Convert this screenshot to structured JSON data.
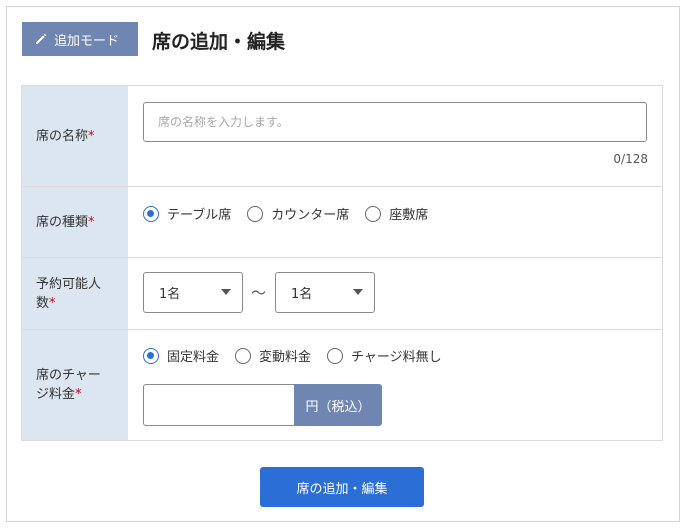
{
  "header": {
    "mode_badge_label": "追加モード",
    "mode_badge_icon": "pencil-icon",
    "title": "席の追加・編集"
  },
  "form": {
    "name": {
      "label": "席の名称",
      "required_mark": "*",
      "placeholder": "席の名称を入力します。",
      "value": "",
      "counter": "0/128"
    },
    "type": {
      "label": "席の種類",
      "required_mark": "*",
      "options": [
        "テーブル席",
        "カウンター席",
        "座敷席"
      ],
      "selected": "テーブル席"
    },
    "capacity": {
      "label_line1": "予約可能人",
      "label_line2": "数",
      "required_mark": "*",
      "min_value": "1名",
      "separator": "〜",
      "max_value": "1名"
    },
    "charge": {
      "label_line1": "席のチャー",
      "label_line2": "ジ料金",
      "required_mark": "*",
      "options": [
        "固定料金",
        "変動料金",
        "チャージ料無し"
      ],
      "selected": "固定料金",
      "amount_value": "",
      "unit_label": "円（税込）"
    }
  },
  "submit_label": "席の追加・編集",
  "colors": {
    "accent": "#2b6fd6",
    "badge": "#6f86b3",
    "label_bg": "#dce6f1",
    "required": "#d0021b"
  }
}
